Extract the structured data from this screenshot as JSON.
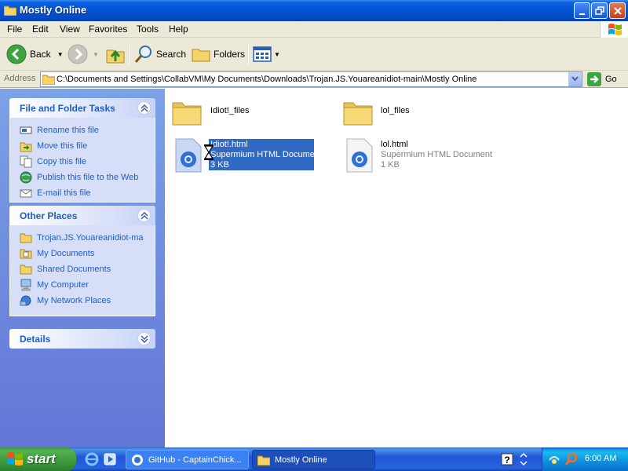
{
  "window": {
    "title": "Mostly Online"
  },
  "menu": [
    "File",
    "Edit",
    "View",
    "Favorites",
    "Tools",
    "Help"
  ],
  "toolbar": {
    "back_label": "Back",
    "search_label": "Search",
    "folders_label": "Folders"
  },
  "address": {
    "label": "Address",
    "path": "C:\\Documents and Settings\\CollabVM\\My Documents\\Downloads\\Trojan.JS.Youareanidiot-main\\Mostly Online",
    "go_label": "Go"
  },
  "left_pane": {
    "file_tasks": {
      "title": "File and Folder Tasks",
      "items": [
        "Rename this file",
        "Move this file",
        "Copy this file",
        "Publish this file to the Web",
        "E-mail this file"
      ]
    },
    "other_places": {
      "title": "Other Places",
      "items": [
        "Trojan.JS.Youareanidiot-ma",
        "My Documents",
        "Shared Documents",
        "My Computer",
        "My Network Places"
      ]
    },
    "details": {
      "title": "Details"
    }
  },
  "files": [
    {
      "name": "Idiot!_files",
      "type": "folder"
    },
    {
      "name": "lol_files",
      "type": "folder"
    },
    {
      "name": "Idiot!.html",
      "kind": "Supermium HTML Document",
      "size": "3 KB",
      "selected": true
    },
    {
      "name": "lol.html",
      "kind": "Supermium HTML Document",
      "size": "1 KB",
      "selected": false
    }
  ],
  "taskbar": {
    "start_label": "start",
    "tasks": [
      {
        "label": "GitHub - CaptainChick...",
        "active": false
      },
      {
        "label": "Mostly Online",
        "active": true
      }
    ],
    "clock": "6:00 AM"
  },
  "colors": {
    "title_bar": "#0553d2",
    "selection": "#316ac5",
    "link": "#215dc6",
    "start_green": "#3d9a3d"
  }
}
